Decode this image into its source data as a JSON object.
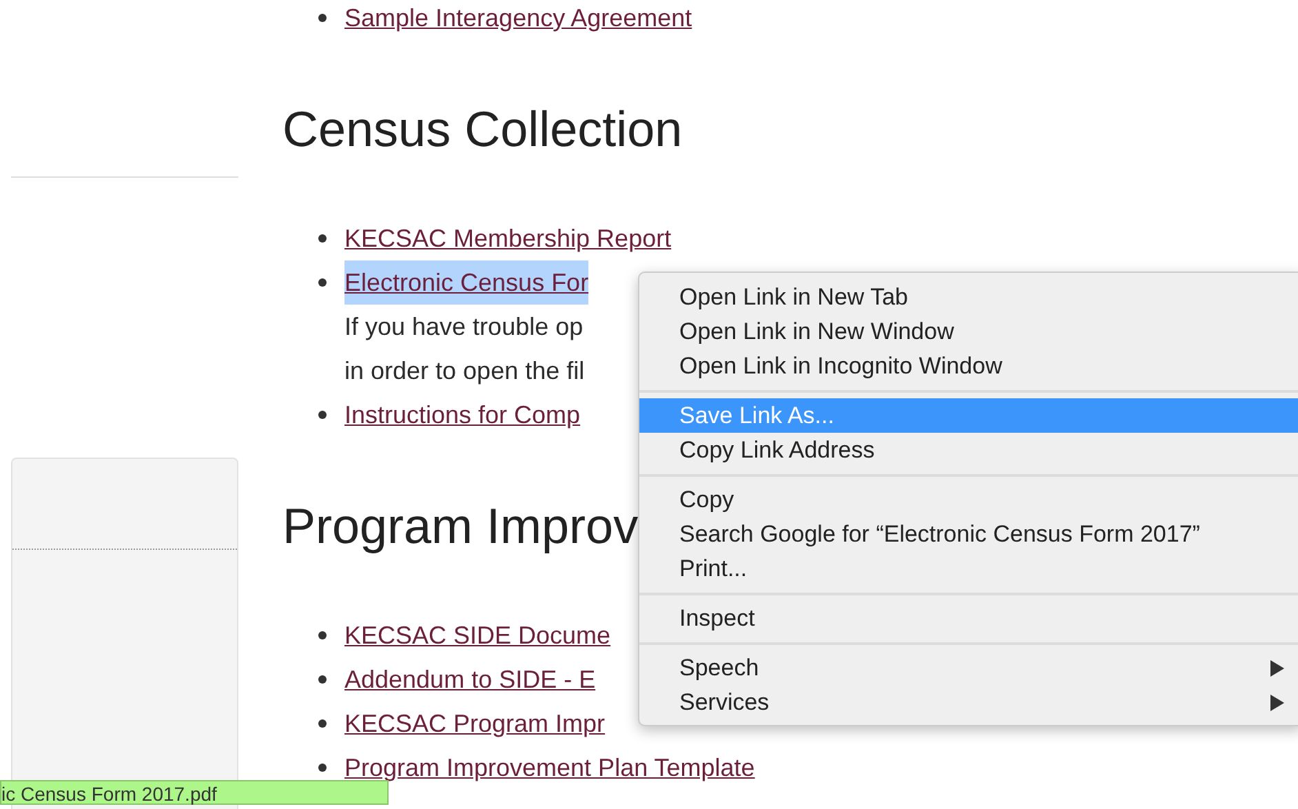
{
  "top_links": [
    {
      "text": "Sample Interagency Agreement"
    }
  ],
  "sections": [
    {
      "heading": "Census Collection",
      "items": [
        {
          "text": "KECSAC Membership Report",
          "selected": false
        },
        {
          "text": "Electronic Census For",
          "selected": true,
          "note": [
            "If you have trouble op",
            "in order to open the fil"
          ]
        },
        {
          "text": "Instructions for Comp",
          "selected": false
        }
      ]
    },
    {
      "heading": "Program Improv",
      "items": [
        {
          "text": "KECSAC SIDE Docume",
          "selected": false
        },
        {
          "text": "Addendum to SIDE - E",
          "selected": false
        },
        {
          "text": "KECSAC Program Impr",
          "selected": false
        },
        {
          "text": "Program Improvement Plan Template",
          "selected": false
        }
      ]
    }
  ],
  "context_menu": {
    "groups": [
      [
        {
          "label": "Open Link in New Tab",
          "selected": false,
          "submenu": false
        },
        {
          "label": "Open Link in New Window",
          "selected": false,
          "submenu": false
        },
        {
          "label": "Open Link in Incognito Window",
          "selected": false,
          "submenu": false
        }
      ],
      [
        {
          "label": "Save Link As...",
          "selected": true,
          "submenu": false
        },
        {
          "label": "Copy Link Address",
          "selected": false,
          "submenu": false
        }
      ],
      [
        {
          "label": "Copy",
          "selected": false,
          "submenu": false
        },
        {
          "label": "Search Google for “Electronic Census Form 2017”",
          "selected": false,
          "submenu": false
        },
        {
          "label": "Print...",
          "selected": false,
          "submenu": false
        }
      ],
      [
        {
          "label": "Inspect",
          "selected": false,
          "submenu": false
        }
      ],
      [
        {
          "label": "Speech",
          "selected": false,
          "submenu": true
        },
        {
          "label": "Services",
          "selected": false,
          "submenu": true
        }
      ]
    ]
  },
  "status_bar": {
    "text": "ic Census Form 2017.pdf"
  }
}
